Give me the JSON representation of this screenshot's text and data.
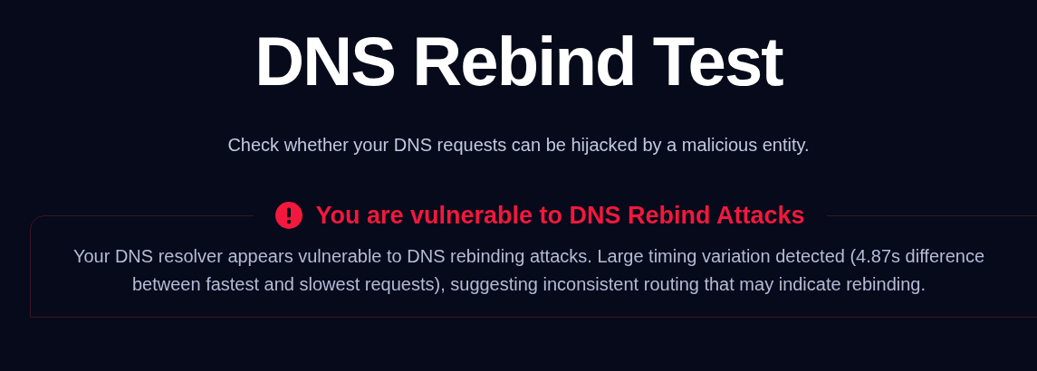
{
  "title": "DNS Rebind Test",
  "subtitle": "Check whether your DNS requests can be hijacked by a malicious entity.",
  "result": {
    "kind": "error",
    "heading": "You are vulnerable to DNS Rebind Attacks",
    "message": "Your DNS resolver appears vulnerable to DNS rebinding attacks. Large timing variation detected (4.87s difference between fastest and slowest requests), suggesting inconsistent routing that may indicate rebinding."
  }
}
